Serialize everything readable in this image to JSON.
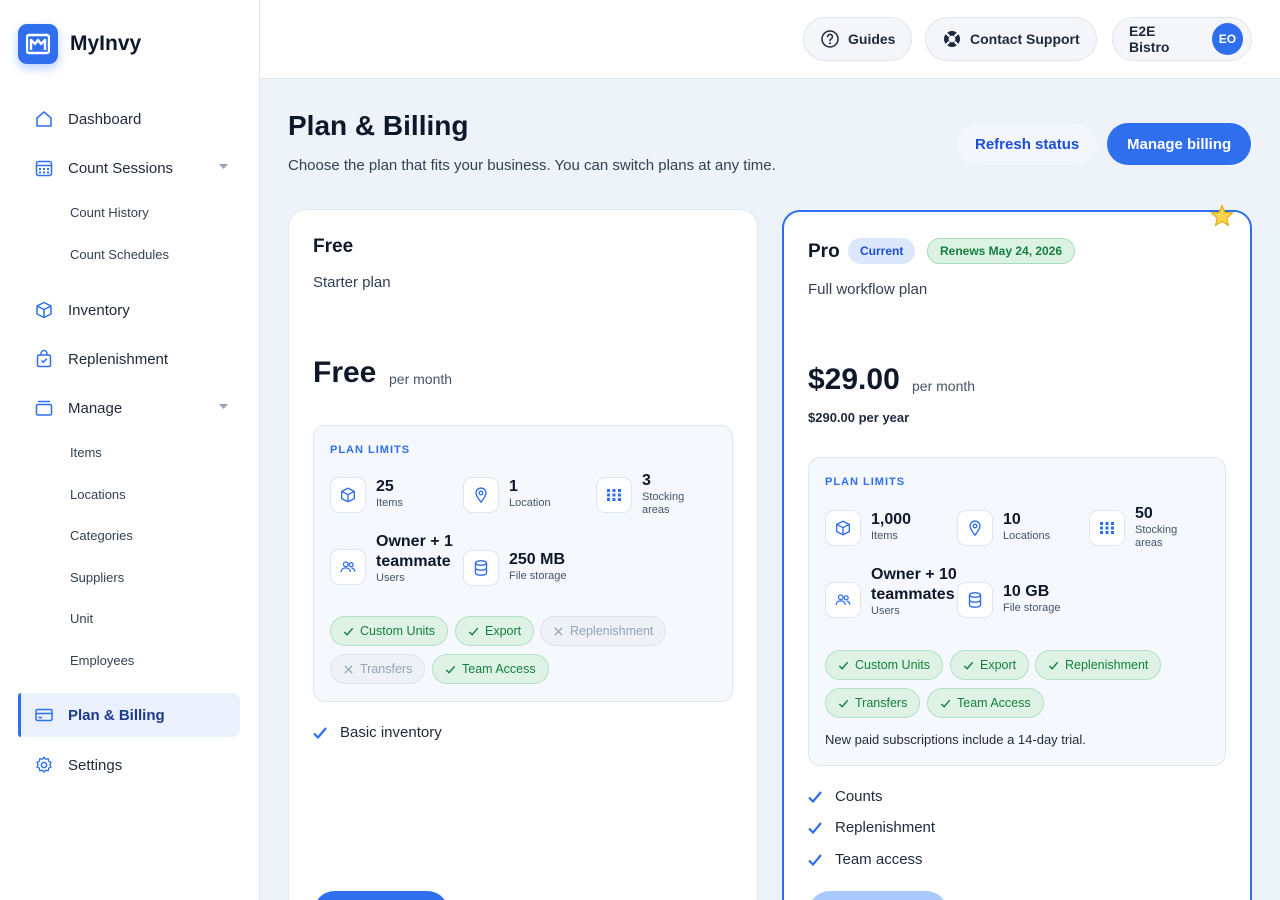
{
  "brand": {
    "name": "MyInvy"
  },
  "sidebar": {
    "items": [
      {
        "label": "Dashboard"
      },
      {
        "label": "Count Sessions"
      },
      {
        "label": "Inventory"
      },
      {
        "label": "Replenishment"
      },
      {
        "label": "Manage"
      },
      {
        "label": "Plan & Billing"
      },
      {
        "label": "Settings"
      }
    ],
    "count_sub": [
      "Count History",
      "Count Schedules"
    ],
    "manage_sub": [
      "Items",
      "Locations",
      "Categories",
      "Suppliers",
      "Unit",
      "Employees"
    ]
  },
  "topbar": {
    "guides": "Guides",
    "support": "Contact Support",
    "org": "E2E Bistro",
    "avatar": "EO"
  },
  "header": {
    "title": "Plan & Billing",
    "subtitle": "Choose the plan that fits your business. You can switch plans at any time.",
    "refresh": "Refresh status",
    "manage": "Manage billing"
  },
  "free": {
    "name": "Free",
    "desc": "Starter plan",
    "price": "Free",
    "per": "per month",
    "limits_title": "PLAN LIMITS",
    "items_val": "25",
    "items_lbl": "Items",
    "loc_val": "1",
    "loc_lbl": "Location",
    "areas_val": "3",
    "areas_lbl": "Stocking areas",
    "users_val": "Owner + 1 teammate",
    "users_lbl": "Users",
    "storage_val": "250 MB",
    "storage_lbl": "File storage",
    "chips": [
      "Custom Units",
      "Export",
      "Replenishment",
      "Transfers",
      "Team Access"
    ],
    "features": [
      "Basic inventory"
    ]
  },
  "pro": {
    "name": "Pro",
    "badge_current": "Current",
    "badge_renews": "Renews May 24, 2026",
    "desc": "Full workflow plan",
    "price": "$29.00",
    "per": "per month",
    "per_year": "$290.00 per year",
    "limits_title": "PLAN LIMITS",
    "items_val": "1,000",
    "items_lbl": "Items",
    "loc_val": "10",
    "loc_lbl": "Locations",
    "areas_val": "50",
    "areas_lbl": "Stocking areas",
    "users_val": "Owner + 10 teammates",
    "users_lbl": "Users",
    "storage_val": "10 GB",
    "storage_lbl": "File storage",
    "chips": [
      "Custom Units",
      "Export",
      "Replenishment",
      "Transfers",
      "Team Access"
    ],
    "trial": "New paid subscriptions include a 14-day trial.",
    "features": [
      "Counts",
      "Replenishment",
      "Team access"
    ]
  },
  "colors": {
    "accent": "#2f6fed",
    "success": "#15803d",
    "muted": "#94a3b8"
  }
}
